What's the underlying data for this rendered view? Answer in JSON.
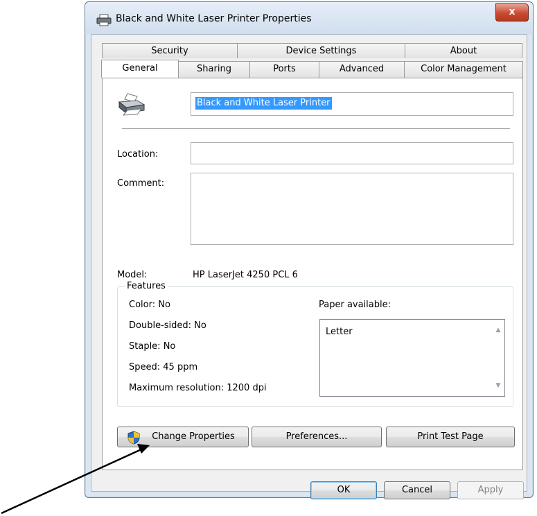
{
  "window": {
    "title": "Black and  White Laser Printer Properties",
    "close_label": "x"
  },
  "tabs": {
    "row_back": [
      "Security",
      "Device Settings",
      "About"
    ],
    "row_front": [
      "General",
      "Sharing",
      "Ports",
      "Advanced",
      "Color Management"
    ],
    "active": "General"
  },
  "general": {
    "printer_name": "Black and  White Laser Printer",
    "location_label": "Location:",
    "location_value": "",
    "comment_label": "Comment:",
    "comment_value": "",
    "model_label": "Model:",
    "model_value": "HP LaserJet 4250 PCL 6",
    "features": {
      "title": "Features",
      "color": "Color: No",
      "double_sided": "Double-sided: No",
      "staple": "Staple: No",
      "speed": "Speed: 45 ppm",
      "max_resolution": "Maximum resolution: 1200 dpi",
      "paper_label": "Paper available:",
      "paper_items": [
        "Letter"
      ]
    },
    "buttons": {
      "change_properties": "Change Properties",
      "preferences": "Preferences...",
      "print_test_page": "Print Test Page"
    }
  },
  "footer": {
    "ok": "OK",
    "cancel": "Cancel",
    "apply": "Apply"
  },
  "colors": {
    "selection": "#3399ff",
    "close_button": "#c84a32",
    "window_frame": "#dbe6f3"
  },
  "icons": [
    "printer-icon",
    "shield-icon",
    "close-icon",
    "scroll-up-icon",
    "scroll-down-icon"
  ]
}
